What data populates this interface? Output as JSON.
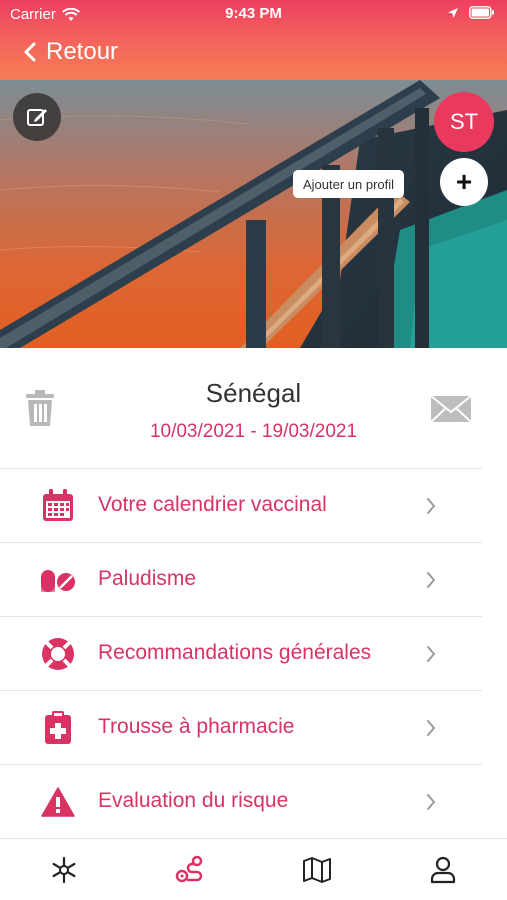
{
  "status_bar": {
    "carrier": "Carrier",
    "time": "9:43 PM"
  },
  "nav": {
    "back_label": "Retour"
  },
  "hero": {
    "avatar_initials": "ST",
    "add_profile_tooltip": "Ajouter un profil",
    "add_symbol": "+"
  },
  "trip": {
    "country": "Sénégal",
    "dates": "10/03/2021 - 19/03/2021"
  },
  "menu": [
    {
      "label": "Votre calendrier vaccinal",
      "icon": "calendar-icon"
    },
    {
      "label": "Paludisme",
      "icon": "pills-icon"
    },
    {
      "label": "Recommandations générales",
      "icon": "lifebuoy-icon"
    },
    {
      "label": "Trousse à pharmacie",
      "icon": "medical-kit-icon"
    },
    {
      "label": "Evaluation du risque",
      "icon": "warning-icon"
    }
  ],
  "tabbar": [
    {
      "icon": "medical-star-icon",
      "active": false
    },
    {
      "icon": "route-icon",
      "active": true
    },
    {
      "icon": "map-icon",
      "active": false
    },
    {
      "icon": "profile-icon",
      "active": false
    }
  ],
  "colors": {
    "accent": "#d93263",
    "header_top": "#ef3f62",
    "header_bottom": "#f67c55"
  }
}
